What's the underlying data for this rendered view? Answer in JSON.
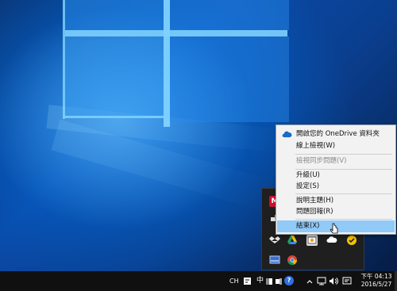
{
  "context_menu": {
    "items": [
      {
        "label": "開啟您的 OneDrive 資料夾",
        "state": "normal",
        "icon": "onedrive-cloud-icon"
      },
      {
        "label": "線上檢視(W)",
        "state": "normal"
      },
      {
        "label": "檢視同步問題(V)",
        "state": "disabled"
      },
      {
        "label": "升級(U)",
        "state": "normal"
      },
      {
        "label": "設定(S)",
        "state": "normal"
      },
      {
        "label": "說明主題(H)",
        "state": "normal"
      },
      {
        "label": "問題回報(R)",
        "state": "normal"
      },
      {
        "label": "結束(X)",
        "state": "highlighted"
      }
    ]
  },
  "tray_flyout": {
    "icons": [
      "mega-icon",
      "network-tray-icon",
      "dropbox-icon",
      "google-drive-icon",
      "app-tray-icon",
      "onedrive-tray-icon",
      "norton-icon",
      "monitor-tray-icon",
      "chrome-icon"
    ]
  },
  "taskbar": {
    "ime_language": "CH",
    "ime_mode": "中",
    "help_icon_glyph": "?",
    "clock": {
      "time": "下午 04:13",
      "date": "2016/5/27"
    },
    "colors": {
      "background": "#101010",
      "menu_highlight": "#91c9f7",
      "onedrive_blue": "#1b6ac9"
    }
  }
}
